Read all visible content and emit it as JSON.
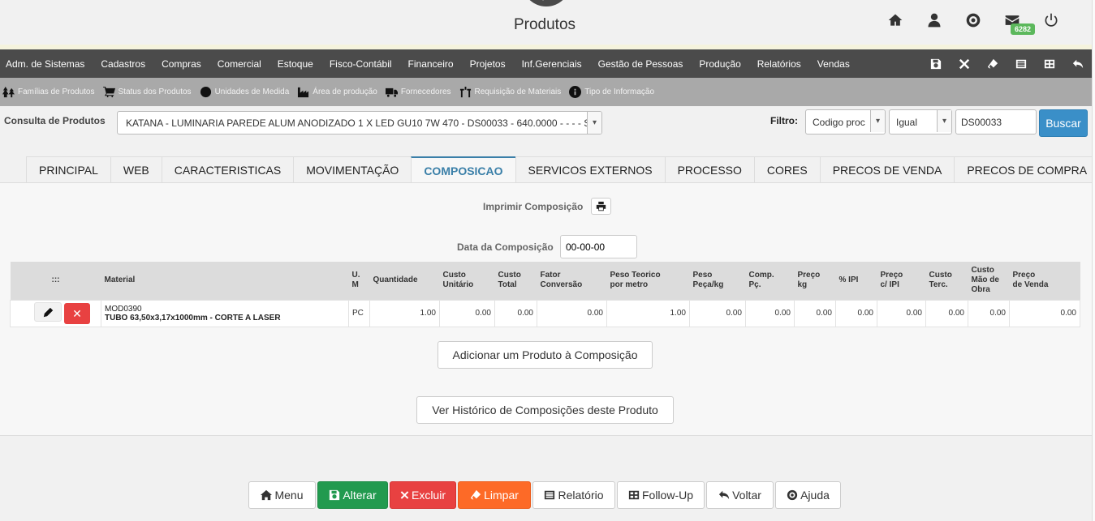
{
  "header": {
    "title": "Produtos",
    "mail_badge": "6282",
    "icons": [
      "home-icon",
      "user-icon",
      "support-icon",
      "mail-icon",
      "power-icon"
    ]
  },
  "menu": {
    "items": [
      "Adm. de Sistemas",
      "Cadastros",
      "Compras",
      "Comercial",
      "Estoque",
      "Fisco-Contábil",
      "Financeiro",
      "Projetos",
      "Inf.Gerenciais",
      "Gestão de Pessoas",
      "Produção",
      "Relatórios",
      "Vendas"
    ],
    "actions": [
      "save-icon",
      "close-icon",
      "eraser-icon",
      "report-icon",
      "table-icon",
      "back-icon"
    ]
  },
  "submenu": {
    "items": [
      "Famílias de Produtos",
      "Status dos Produtos",
      "Unidades de Medida",
      "Área de produção",
      "Fornecedores",
      "Requisição de Materiais",
      "Tipo de Informação"
    ]
  },
  "consulta": {
    "label": "Consulta de Produtos",
    "selected": "KATANA - LUMINARIA PAREDE ALUM ANODIZADO 1 X LED GU10 7W 470 - DS00033 - 640.0000 - - - - S"
  },
  "filtro": {
    "label": "Filtro:",
    "field": "Codigo proc",
    "operator": "Igual",
    "value": "DS00033",
    "search_label": "Buscar"
  },
  "tabs": [
    {
      "label": "PRINCIPAL",
      "active": false
    },
    {
      "label": "WEB",
      "active": false
    },
    {
      "label": "CARACTERISTICAS",
      "active": false
    },
    {
      "label": "MOVIMENTAÇÃO",
      "active": false
    },
    {
      "label": "COMPOSICAO",
      "active": true
    },
    {
      "label": "SERVICOS EXTERNOS",
      "active": false
    },
    {
      "label": "PROCESSO",
      "active": false
    },
    {
      "label": "CORES",
      "active": false
    },
    {
      "label": "PRECOS DE VENDA",
      "active": false
    },
    {
      "label": "PRECOS DE COMPRA",
      "active": false
    }
  ],
  "composicao": {
    "print_label": "Imprimir Composição",
    "date_label": "Data da Composição",
    "date_value": "00-00-00",
    "columns": [
      ":::",
      "Material",
      "U.\nM",
      "Quantidade",
      "Custo\nUnitário",
      "Custo\nTotal",
      "Fator\nConversão",
      "Peso Teorico\npor metro",
      "Peso\nPeça/kg",
      "Comp.\nPç.",
      "Preço\nkg",
      "% IPI",
      "Preço\nc/ IPI",
      "Custo\nTerc.",
      "Custo\nMão de\nObra",
      "Preço\nde Venda"
    ],
    "rows": [
      {
        "code": "MOD0390",
        "description": "TUBO 63,50x3,17x1000mm - CORTE A LASER",
        "um": "PC",
        "values": [
          "1.00",
          "0.00",
          "0.00",
          "0.00",
          "1.00",
          "0.00",
          "0.00",
          "0.00",
          "0.00",
          "0.00",
          "0.00",
          "0.00",
          "0.00"
        ]
      }
    ],
    "add_label": "Adicionar um Produto à Composição",
    "history_label": "Ver Histórico de Composições deste Produto"
  },
  "bottom": {
    "menu": "Menu",
    "alterar": "Alterar",
    "excluir": "Excluir",
    "limpar": "Limpar",
    "relatorio": "Relatório",
    "followup": "Follow-Up",
    "voltar": "Voltar",
    "ajuda": "Ajuda"
  },
  "colors": {
    "menubar": "#4b4b4b",
    "submenu": "#a9a9a9",
    "primary": "#3a8fc8",
    "success": "#229a4f",
    "danger": "#e84141",
    "warning": "#fd6a27",
    "active_tab": "#3a7fa8"
  }
}
